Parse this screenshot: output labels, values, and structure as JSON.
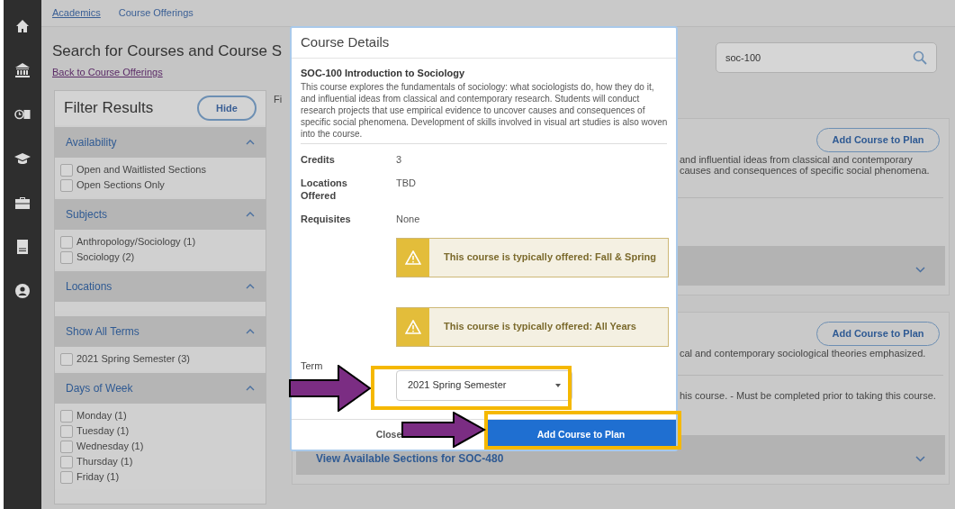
{
  "breadcrumb": [
    {
      "label": "Academics",
      "link": true
    },
    {
      "label": "Course Offerings",
      "link": false
    }
  ],
  "page_title": "Search for Courses and Course S",
  "back_link": "Back to Course Offerings",
  "search": {
    "value": "soc-100"
  },
  "filter": {
    "title": "Filter Results",
    "hide_button": "Hide",
    "sections": [
      {
        "title": "Availability",
        "expanded": true,
        "options": [
          {
            "label": "Open and Waitlisted Sections",
            "checked": false
          },
          {
            "label": "Open Sections Only",
            "checked": false
          }
        ]
      },
      {
        "title": "Subjects",
        "expanded": true,
        "options": [
          {
            "label": "Anthropology/Sociology (1)",
            "checked": false
          },
          {
            "label": "Sociology (2)",
            "checked": false
          }
        ]
      },
      {
        "title": "Locations",
        "expanded": true
      },
      {
        "title": "Show All Terms",
        "expanded": true,
        "options": [
          {
            "label": "2021 Spring Semester (3)",
            "checked": false
          }
        ]
      },
      {
        "title": "Days of Week",
        "expanded": true,
        "options": [
          {
            "label": "Monday (1)",
            "checked": false
          },
          {
            "label": "Tuesday (1)",
            "checked": false
          },
          {
            "label": "Wednesday (1)",
            "checked": false
          },
          {
            "label": "Thursday (1)",
            "checked": false
          },
          {
            "label": "Friday (1)",
            "checked": false
          }
        ]
      }
    ]
  },
  "results": {
    "label": "Fi",
    "cards": [
      {
        "button": "Add Course to Plan",
        "lines": [
          "and influential ideas from classical and contemporary",
          "causes and consequences of specific social phenomena."
        ]
      },
      {
        "button": "Add Course to Plan",
        "lines": [
          "cal and contemporary sociological theories emphasized."
        ],
        "extra": "his course. - Must be completed prior to taking this course.",
        "sections_link": "View Available Sections for SOC-480"
      }
    ]
  },
  "modal": {
    "title": "Course Details",
    "course_title": "SOC-100 Introduction to Sociology",
    "description": "This course explores the fundamentals of sociology: what sociologists do, how they do it, and influential ideas from classical and contemporary research. Students will conduct research projects that use empirical evidence to uncover causes and consequences of specific social phenomena. Development of skills involved in visual art studies is also woven into the course.",
    "details": [
      {
        "label": "Credits",
        "value": "3"
      },
      {
        "label": "Locations Offered",
        "value": "TBD"
      },
      {
        "label": "Requisites",
        "value": "None"
      }
    ],
    "notices": [
      "This course is typically offered: Fall & Spring",
      "This course is typically offered: All Years"
    ],
    "term": {
      "label": "Term",
      "value": "2021 Spring Semester"
    },
    "close_button": "Close",
    "primary_button": "Add Course to Plan"
  }
}
